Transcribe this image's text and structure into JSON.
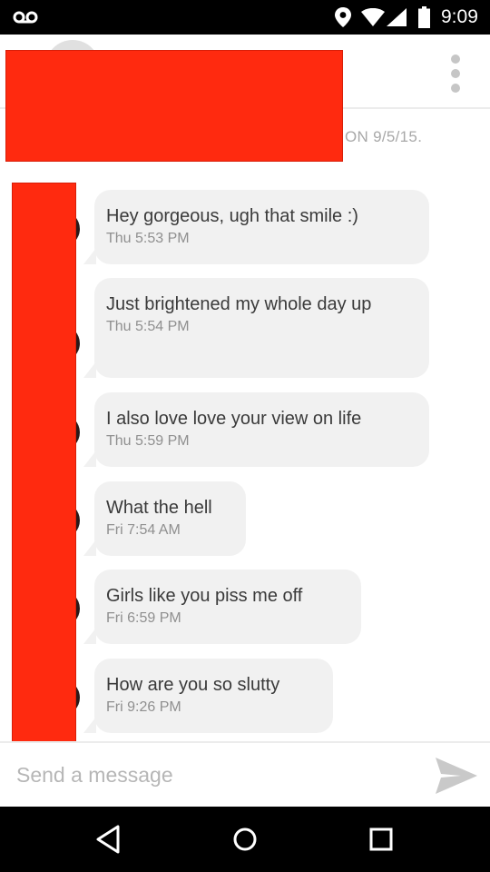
{
  "status_bar": {
    "time": "9:09",
    "icons": [
      "voicemail-icon",
      "location-icon",
      "wifi-icon",
      "signal-icon",
      "battery-icon"
    ]
  },
  "header": {
    "contact_name": "",
    "menu_icon": "more-vert-icon"
  },
  "conversation": {
    "match_date_visible": "ON 9/5/15.",
    "messages": [
      {
        "text": "Hey gorgeous,  ugh that smile :)",
        "time": "Thu  5:53 PM"
      },
      {
        "text": "Just brightened my whole day up",
        "time": "Thu  5:54 PM"
      },
      {
        "text": "I also love love your view on life",
        "time": "Thu  5:59 PM"
      },
      {
        "text": "What the hell",
        "time": "Fri  7:54 AM"
      },
      {
        "text": "Girls like you piss me off",
        "time": "Fri  6:59 PM"
      },
      {
        "text": "How are you so slutty",
        "time": "Fri  9:26 PM"
      }
    ]
  },
  "composer": {
    "placeholder": "Send a message",
    "value": "",
    "send_icon": "send-icon"
  },
  "nav_bar": {
    "icons": [
      "back-icon",
      "home-icon",
      "recents-icon"
    ]
  },
  "colors": {
    "redaction": "#ff2a0f",
    "bubble": "#f1f1f1",
    "message_text": "#3a3a3a",
    "timestamp": "#8f8f8f",
    "placeholder": "#b6b6b6"
  }
}
